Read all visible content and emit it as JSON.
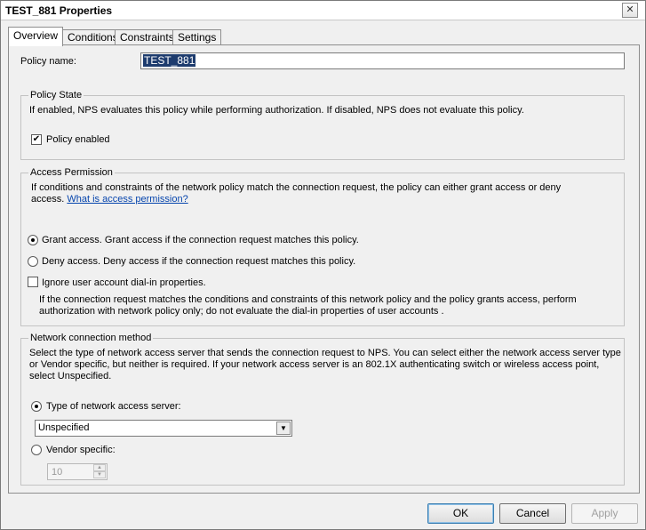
{
  "window": {
    "title": "TEST_881 Properties",
    "close_glyph": "✕"
  },
  "tabs": [
    {
      "label": "Overview"
    },
    {
      "label": "Conditions"
    },
    {
      "label": "Constraints"
    },
    {
      "label": "Settings"
    }
  ],
  "overview": {
    "policy_name_label": "Policy name:",
    "policy_name_value": "TEST_881",
    "policy_state": {
      "title": "Policy State",
      "description": "If enabled, NPS evaluates this policy while performing authorization. If disabled, NPS does not evaluate this policy.",
      "enabled_label": "Policy enabled",
      "enabled_checked": true
    },
    "access_permission": {
      "title": "Access Permission",
      "description_line1": "If conditions and constraints of the network policy match the connection request, the policy can either grant access or deny",
      "description_line2": "access.",
      "link_text": "What is access permission?",
      "grant_label": "Grant access. Grant access if the connection request matches this policy.",
      "deny_label": "Deny access. Deny access if the connection request matches this policy.",
      "ignore_label": "Ignore user account dial-in properties.",
      "ignore_desc_line1": "If the connection request matches the conditions and constraints of this network policy and the policy grants access, perform",
      "ignore_desc_line2": "authorization with network policy only; do not evaluate the dial-in properties of user accounts .",
      "selected": "grant",
      "ignore_checked": false
    },
    "network_method": {
      "title": "Network connection method",
      "description_line1": "Select the type of network access server that sends the connection request to NPS. You can select either the network access server type",
      "description_line2": "or Vendor specific, but neither is required.  If your network access server is an 802.1X authenticating switch or wireless access point,",
      "description_line3": "select Unspecified.",
      "type_label": "Type of network access server:",
      "type_value": "Unspecified",
      "vendor_label": "Vendor specific:",
      "vendor_value": "10",
      "selected": "type"
    }
  },
  "buttons": {
    "ok": "OK",
    "cancel": "Cancel",
    "apply": "Apply"
  },
  "icons": {
    "checkmark": "✔",
    "dropdown": "▼",
    "spin_up": "▲",
    "spin_down": "▼"
  }
}
